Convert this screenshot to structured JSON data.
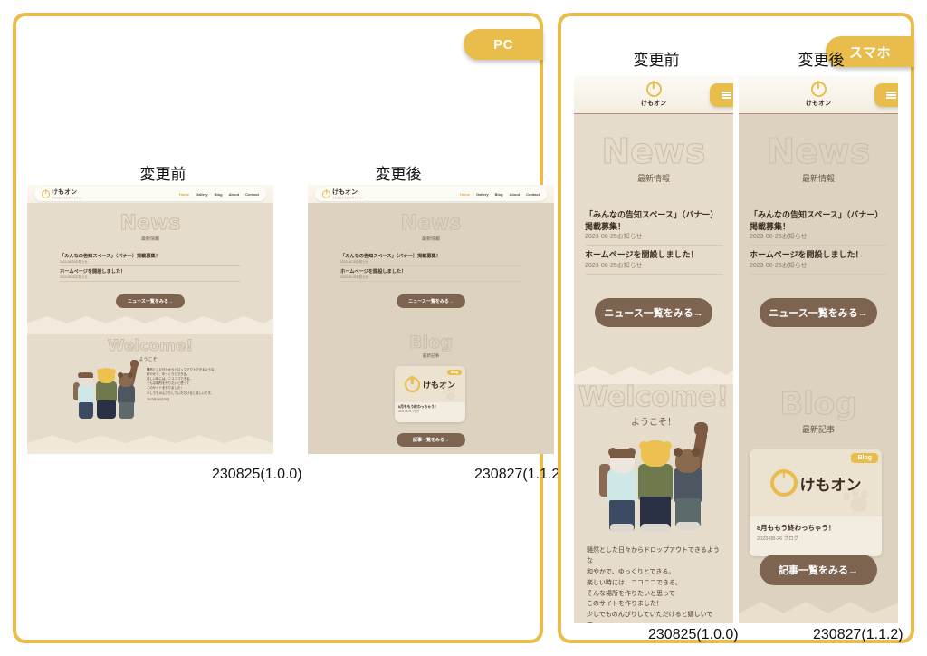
{
  "panels": {
    "pc": {
      "badge": "PC"
    },
    "sp": {
      "badge": "スマホ"
    }
  },
  "captions": {
    "before": "変更前",
    "after": "変更後"
  },
  "versions": {
    "before": "230825(1.0.0)",
    "after": "230827(1.1.2)"
  },
  "site": {
    "logo": {
      "name": "けもオン",
      "sub": "けものおともだちギャラリー",
      "icon": "power-icon"
    },
    "nav": [
      {
        "label": "Home",
        "active": true
      },
      {
        "label": "Gallery",
        "active": false
      },
      {
        "label": "Blog",
        "active": false
      },
      {
        "label": "About",
        "active": false
      },
      {
        "label": "Contact",
        "active": false
      }
    ],
    "hamburger_icon": "hamburger-menu-icon",
    "news": {
      "heading": "News",
      "subheading": "最新情報",
      "items": [
        {
          "title": "「みんなの告知スペース」（バナー）掲載募集！",
          "date": "2023-08-25お知らせ"
        },
        {
          "title": "ホームページを開設しました！",
          "date": "2023-08-25お知らせ"
        }
      ],
      "button": "ニュース一覧をみる→"
    },
    "welcome": {
      "heading": "Welcome!",
      "subheading": "ようこそ！",
      "body_lines": [
        "騒然とした日々からドロップアウトできるような",
        "和やかで、ゆっくりとできる。",
        "楽しい時には、ニコニコできる。",
        "そんな場所を作りたいと思って",
        "このサイトを作りました！",
        "少しでものんびりしていただけると嬉しいです。"
      ],
      "signature_date": "2023年08月25日",
      "illustration": "three-furry-characters-waving"
    },
    "blog": {
      "heading": "Blog",
      "subheading": "最新記事",
      "tag": "Blog",
      "card_title": "8月ももう終わっちゃう！",
      "card_date": "2023-08-26 ブログ",
      "button": "記事一覧をみる→"
    }
  },
  "colors": {
    "accent": "#e8bd4c",
    "brown": "#7d6450",
    "page_bg": "#e6dccb",
    "header_bg": "#faf6ec",
    "text_dark": "#3b2d22"
  }
}
